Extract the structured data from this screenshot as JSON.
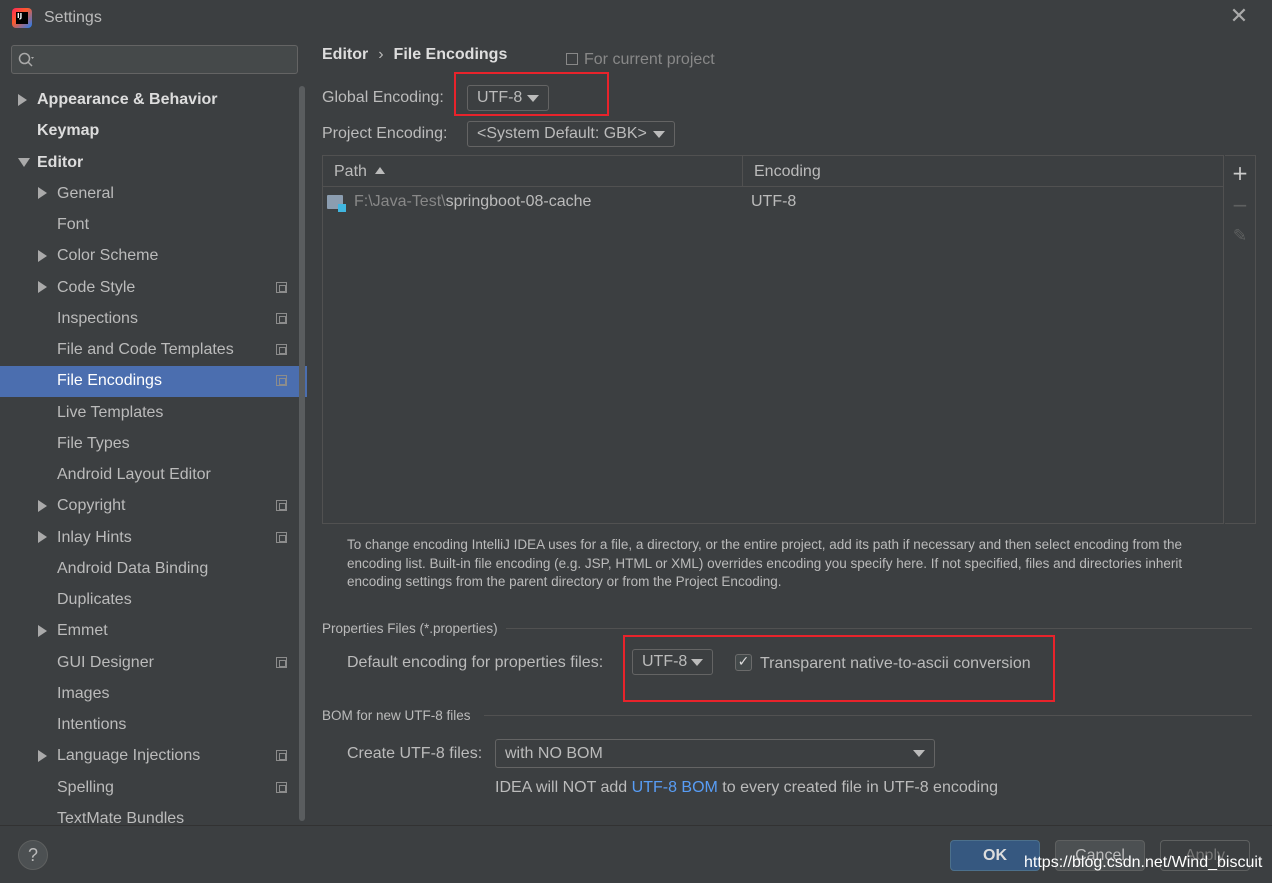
{
  "window": {
    "title": "Settings",
    "close_glyph": "✕",
    "app_icon": "intellij-idea-icon",
    "app_icon_text": "IJ"
  },
  "search": {
    "placeholder": "",
    "value": ""
  },
  "sidebar": {
    "items": [
      {
        "label": "Appearance & Behavior",
        "level": 0,
        "bold": true,
        "arrow": "right",
        "copy_icon": false
      },
      {
        "label": "Keymap",
        "level": 0,
        "bold": true,
        "arrow": "none",
        "copy_icon": false
      },
      {
        "label": "Editor",
        "level": 0,
        "bold": true,
        "arrow": "down",
        "copy_icon": false
      },
      {
        "label": "General",
        "level": 1,
        "arrow": "right",
        "copy_icon": false
      },
      {
        "label": "Font",
        "level": 1,
        "arrow": "none",
        "copy_icon": false
      },
      {
        "label": "Color Scheme",
        "level": 1,
        "arrow": "right",
        "copy_icon": false
      },
      {
        "label": "Code Style",
        "level": 1,
        "arrow": "right",
        "copy_icon": true
      },
      {
        "label": "Inspections",
        "level": 1,
        "arrow": "none",
        "copy_icon": true
      },
      {
        "label": "File and Code Templates",
        "level": 1,
        "arrow": "none",
        "copy_icon": true
      },
      {
        "label": "File Encodings",
        "level": 1,
        "arrow": "none",
        "copy_icon": true,
        "selected": true
      },
      {
        "label": "Live Templates",
        "level": 1,
        "arrow": "none",
        "copy_icon": false
      },
      {
        "label": "File Types",
        "level": 1,
        "arrow": "none",
        "copy_icon": false
      },
      {
        "label": "Android Layout Editor",
        "level": 1,
        "arrow": "none",
        "copy_icon": false
      },
      {
        "label": "Copyright",
        "level": 1,
        "arrow": "right",
        "copy_icon": true
      },
      {
        "label": "Inlay Hints",
        "level": 1,
        "arrow": "right",
        "copy_icon": true
      },
      {
        "label": "Android Data Binding",
        "level": 1,
        "arrow": "none",
        "copy_icon": false
      },
      {
        "label": "Duplicates",
        "level": 1,
        "arrow": "none",
        "copy_icon": false
      },
      {
        "label": "Emmet",
        "level": 1,
        "arrow": "right",
        "copy_icon": false
      },
      {
        "label": "GUI Designer",
        "level": 1,
        "arrow": "none",
        "copy_icon": true
      },
      {
        "label": "Images",
        "level": 1,
        "arrow": "none",
        "copy_icon": false
      },
      {
        "label": "Intentions",
        "level": 1,
        "arrow": "none",
        "copy_icon": false
      },
      {
        "label": "Language Injections",
        "level": 1,
        "arrow": "right",
        "copy_icon": true
      },
      {
        "label": "Spelling",
        "level": 1,
        "arrow": "none",
        "copy_icon": true
      },
      {
        "label": "TextMate Bundles",
        "level": 1,
        "arrow": "none",
        "copy_icon": false
      }
    ]
  },
  "breadcrumb": {
    "parent": "Editor",
    "separator": "›",
    "current": "File Encodings",
    "scope": "For current project"
  },
  "global_encoding": {
    "label": "Global Encoding:",
    "value": "UTF-8"
  },
  "project_encoding": {
    "label": "Project Encoding:",
    "value": "<System Default: GBK>"
  },
  "table": {
    "columns": [
      "Path",
      "Encoding"
    ],
    "rows": [
      {
        "path_prefix": "F:\\Java-Test\\",
        "path_name": "springboot-08-cache",
        "encoding": "UTF-8"
      }
    ],
    "tools": {
      "add": "+",
      "remove": "−",
      "edit": "✎"
    }
  },
  "help_text": "To change encoding IntelliJ IDEA uses for a file, a directory, or the entire project, add its path if necessary and then select encoding from the encoding list. Built-in file encoding (e.g. JSP, HTML or XML) overrides encoding you specify here. If not specified, files and directories inherit encoding settings from the parent directory or from the Project Encoding.",
  "properties": {
    "section_title": "Properties Files (*.properties)",
    "label": "Default encoding for properties files:",
    "value": "UTF-8",
    "checkbox_label": "Transparent native-to-ascii conversion",
    "checkbox_checked": true,
    "check_glyph": "✓"
  },
  "bom": {
    "section_title": "BOM for new UTF-8 files",
    "label": "Create UTF-8 files:",
    "value": "with NO BOM",
    "note_before": "IDEA will NOT add ",
    "note_link": "UTF-8 BOM",
    "note_after": " to every created file in UTF-8 encoding"
  },
  "footer": {
    "help": "?",
    "ok": "OK",
    "cancel": "Cancel",
    "apply": "Apply"
  },
  "watermark": "https://blog.csdn.net/Wind_biscuit",
  "colors": {
    "background": "#3c3f41",
    "selection": "#4b6eaf",
    "highlight_box": "#e8232b",
    "link": "#589df6",
    "ok_button": "#365880"
  }
}
